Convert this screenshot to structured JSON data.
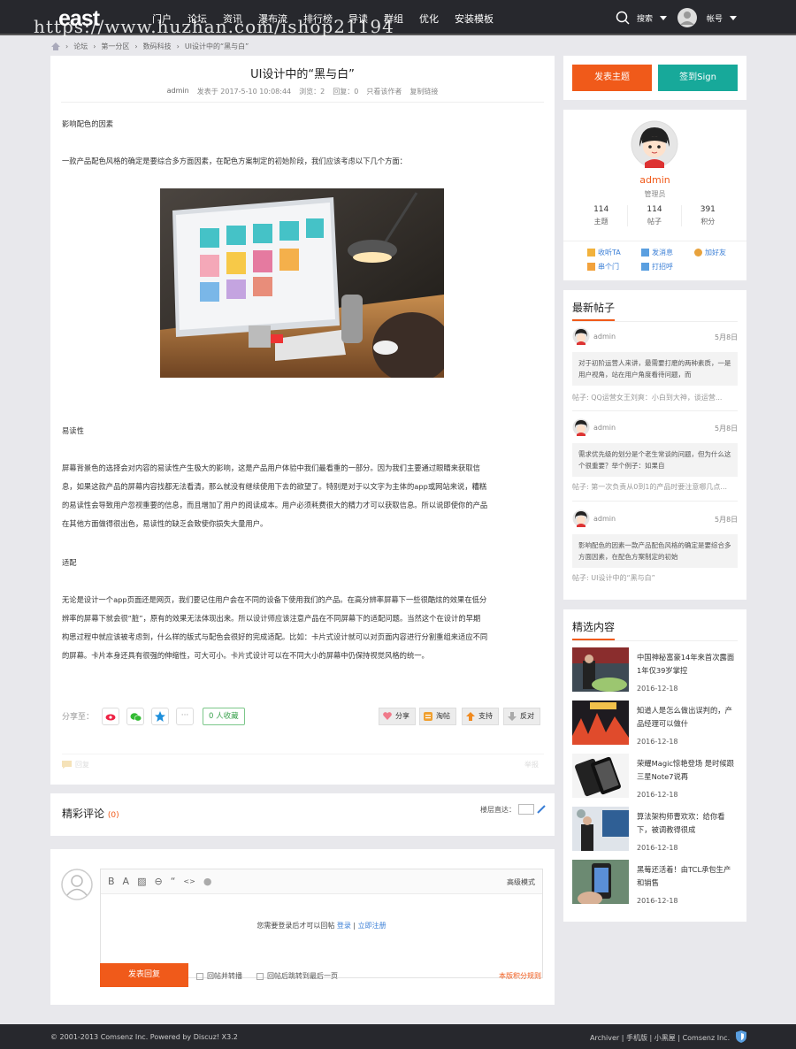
{
  "header": {
    "logo": "east",
    "nav": [
      "门户",
      "论坛",
      "资讯",
      "瀑布流",
      "排行榜",
      "导读",
      "群组",
      "优化",
      "安装模板"
    ],
    "search": "搜索",
    "account": "帐号",
    "watermark": "https://www.huzhan.com/ishop21194"
  },
  "breadcrumb": [
    "论坛",
    "第一分区",
    "数码科技",
    "UI设计中的“黑与白”"
  ],
  "article": {
    "title": "UI设计中的“黑与白”",
    "author": "admin",
    "posted": "发表于 2017-5-10 10:08:44",
    "views": "浏览：2",
    "replies": "回复：0",
    "only_author": "只看该作者",
    "copy_link": "复制链接",
    "p1": "影响配色的因素",
    "p2": "一款产品配色风格的确定是要综合多方面因素，在配色方案制定的初始阶段，我们应该考虑以下几个方面：",
    "p3": "易读性",
    "p4": [
      "屏幕背景色的选择会对内容的易读性产生极大的影响，这是产品用户体验中我们最看重的一部分。因为我们主要通过眼睛来获取信",
      "息，如果这款产品的屏幕内容找都无法看清，那么就没有继续使用下去的欲望了。特别是对于以文字为主体的app或网站来说，糟糕",
      "的易读性会导致用户忽视重要的信息，而且增加了用户的阅读成本。用户必须耗费很大的精力才可以获取信息。所以说即使你的产品",
      "在其他方面做得很出色，易读性的缺乏会致使你损失大量用户。"
    ],
    "p5": "适配",
    "p6": [
      "无论是设计一个app页面还是网页，我们要记住用户会在不同的设备下使用我们的产品。在高分辨率屏幕下一些很酷炫的效果在低分",
      "辨率的屏幕下就会很“脏”，原有的效果无法体现出来。所以设计师应该注意产品在不同屏幕下的适配问题。当然这个在设计的早期",
      "构思过程中就应该被考虑到，什么样的版式与配色会很好的完成适配。比如：卡片式设计就可以对页面内容进行分割重组来适应不同",
      "的屏幕。卡片本身还具有很强的伸缩性，可大可小。卡片式设计可以在不同大小的屏幕中仍保持视觉风格的统一。"
    ],
    "share_label": "分享至：",
    "favorites": "0 人收藏",
    "actions": [
      "分享",
      "淘帖",
      "支持",
      "反对"
    ],
    "bottom_left": "回复",
    "bottom_right": "举报"
  },
  "comments": {
    "title": "精彩评论",
    "count": "(0)",
    "floor_jump": "楼层直达："
  },
  "reply": {
    "tools": [
      "B",
      "A",
      "▨",
      "⊖",
      "“",
      "<>",
      "●"
    ],
    "advanced": "高级模式",
    "login_text": "您需要登录后才可以回帖",
    "login": "登录",
    "sep": "|",
    "register": "立即注册",
    "submit": "发表回复",
    "opt1": "回帖并转播",
    "opt2": "回帖后跳转到最后一页",
    "rules": "本版积分规则"
  },
  "sidebar": {
    "post_btn": "发表主题",
    "sign_btn": "签到Sign",
    "profile": {
      "name": "admin",
      "role": "管理员",
      "stats": [
        {
          "v": "114",
          "l": "主题"
        },
        {
          "v": "114",
          "l": "帖子"
        },
        {
          "v": "391",
          "l": "积分"
        }
      ],
      "actions": [
        "收听TA",
        "发消息",
        "加好友",
        "串个门",
        "打招呼"
      ]
    },
    "latest_title": "最新帖子",
    "latest": [
      {
        "user": "admin",
        "date": "5月8日",
        "excerpt": "对于初阶运营人来讲，最需要打磨的两种素质，一是用户视角，站在用户角度看待问题，而",
        "meta": "帖子: QQ运营女王刘爽：小白到大神，谈运营..."
      },
      {
        "user": "admin",
        "date": "5月8日",
        "excerpt": "需求优先级的划分是个老生常谈的问题，但为什么这个很重要？举个例子：如果自",
        "meta": "帖子: 第一次负责从0到1的产品时要注意哪几点..."
      },
      {
        "user": "admin",
        "date": "5月8日",
        "excerpt": "影响配色的因素一款产品配色风格的确定是要综合多方面因素，在配色方案制定的初始",
        "meta": "帖子: UI设计中的“黑与白”"
      }
    ],
    "featured_title": "精选内容",
    "featured": [
      {
        "title": "中国神秘富豪14年来首次露面1年仅39岁掌控",
        "date": "2016-12-18"
      },
      {
        "title": "知道人是怎么做出误判的，产品经理可以做什",
        "date": "2016-12-18"
      },
      {
        "title": "荣耀Magic惊艳登场 是时候跟三星Note7说再",
        "date": "2016-12-18"
      },
      {
        "title": "算法架构师曹欢欢：给你看下，被调教得很成",
        "date": "2016-12-18"
      },
      {
        "title": "黑莓还活着！由TCL承包生产和销售",
        "date": "2016-12-18"
      }
    ]
  },
  "footer": {
    "copyright": "© 2001-2013 Comsenz Inc.  Powered by Discuz! X3.2",
    "links": "Archiver | 手机版 | 小黑屋 | Comsenz Inc."
  },
  "colors": {
    "accent": "#f05a1a",
    "teal": "#17a99a",
    "dark": "#27282d"
  }
}
